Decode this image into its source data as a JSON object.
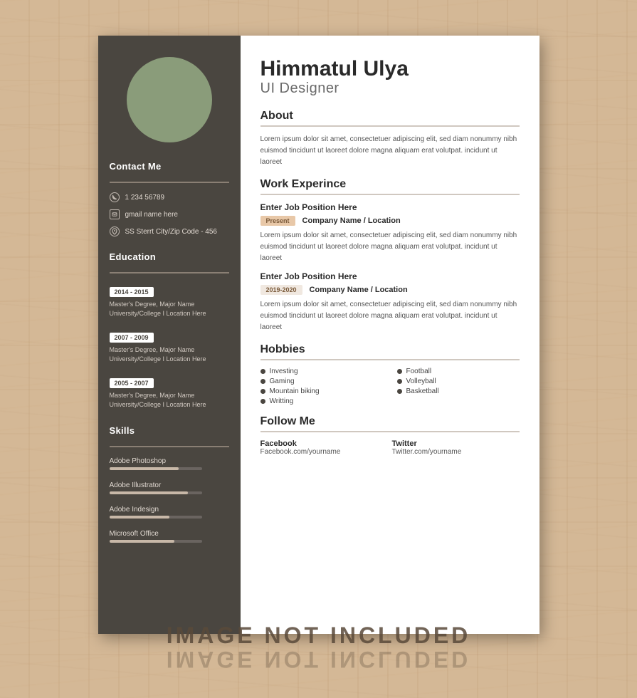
{
  "person": {
    "name": "Himmatul Ulya",
    "title": "UI Designer"
  },
  "contact": {
    "section_title": "Contact Me",
    "phone": "1 234 56789",
    "email": "gmail name here",
    "address": "SS Sterrt City/Zip Code - 456"
  },
  "education": {
    "section_title": "Education",
    "entries": [
      {
        "years": "2014 - 2015",
        "detail": "Master's Degree, Major Name\nUniversity/College I  Location Here"
      },
      {
        "years": "2007 - 2009",
        "detail": "Master's Degree, Major Name\nUniversity/College I  Location Here"
      },
      {
        "years": "2005 - 2007",
        "detail": "Master's Degree, Major Name\nUniversity/College I  Location Here"
      }
    ]
  },
  "skills": {
    "section_title": "Skills",
    "entries": [
      {
        "name": "Adobe Photoshop",
        "percent": 75
      },
      {
        "name": "Adobe Illustrator",
        "percent": 85
      },
      {
        "name": "Adobe Indesign",
        "percent": 65
      },
      {
        "name": "Microsoft Office",
        "percent": 70
      }
    ]
  },
  "about": {
    "section_title": "About",
    "text": "Lorem ipsum dolor sit amet, consectetuer adipiscing elit, sed diam nonummy nibh euismod tincidunt ut laoreet dolore magna aliquam erat volutpat. incidunt ut laoreet"
  },
  "work_experience": {
    "section_title": "Work Experince",
    "jobs": [
      {
        "position": "Enter Job Position Here",
        "badge": "Present",
        "badge_type": "present",
        "company": "Company Name / Location",
        "description": "Lorem ipsum dolor sit amet, consectetuer adipiscing elit, sed diam nonummy nibh euismod tincidunt ut laoreet dolore magna aliquam erat volutpat. incidunt ut laoreet"
      },
      {
        "position": "Enter Job Position Here",
        "badge": "2019-2020",
        "badge_type": "year",
        "company": "Company Name / Location",
        "description": "Lorem ipsum dolor sit amet, consectetuer adipiscing elit, sed diam nonummy nibh euismod tincidunt ut laoreet dolore magna aliquam erat volutpat. incidunt ut laoreet"
      }
    ]
  },
  "hobbies": {
    "section_title": "Hobbies",
    "items": [
      {
        "name": "Investing",
        "col": 1
      },
      {
        "name": "Football",
        "col": 2
      },
      {
        "name": "Gaming",
        "col": 1
      },
      {
        "name": "Volleyball",
        "col": 2
      },
      {
        "name": "Mountain biking",
        "col": 1
      },
      {
        "name": "Basketball",
        "col": 2
      },
      {
        "name": "Writting",
        "col": 1
      }
    ]
  },
  "follow": {
    "section_title": "Follow Me",
    "items": [
      {
        "platform": "Facebook",
        "url": "Facebook.com/yourname"
      },
      {
        "platform": "Twitter",
        "url": "Twitter.com/yourname"
      }
    ]
  },
  "watermark": "IMAGE NOT INCLUDED"
}
